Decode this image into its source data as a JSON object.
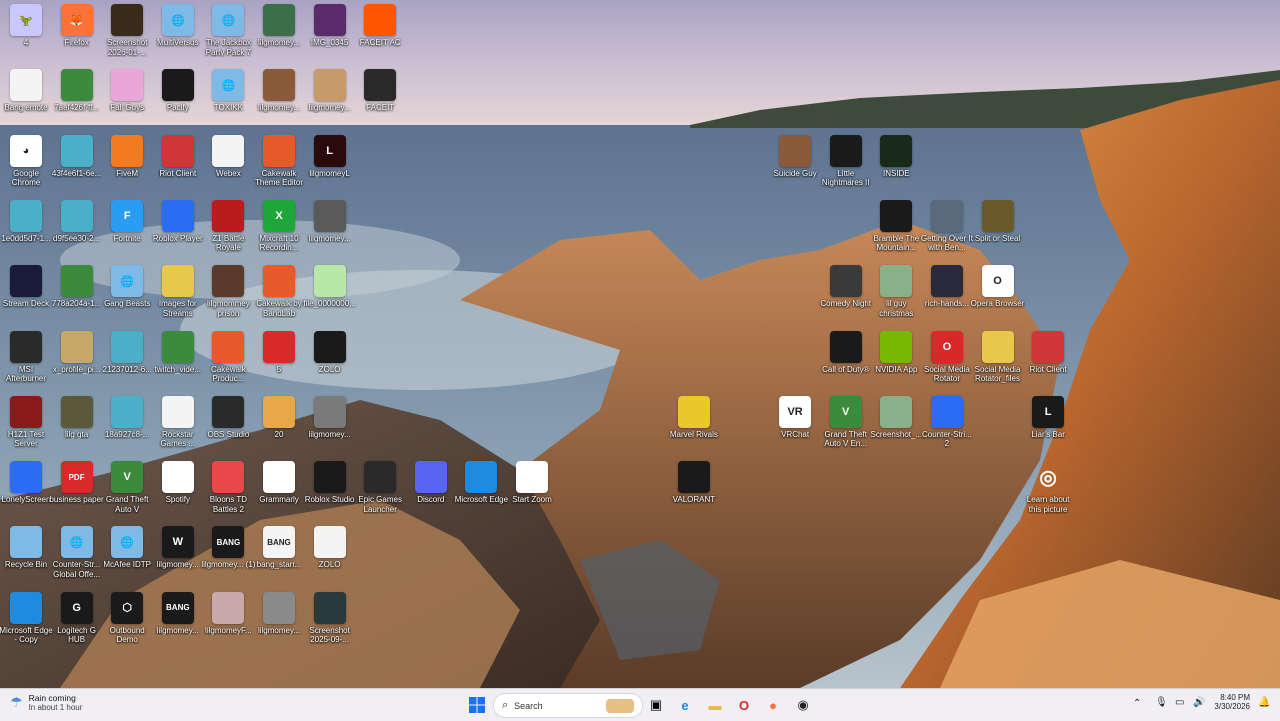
{
  "desktop": {
    "icons": [
      {
        "label": "4",
        "color": "#c8c8ff",
        "glyph": "🦖"
      },
      {
        "label": "Firefox",
        "color": "#ff7139",
        "glyph": "🦊"
      },
      {
        "label": "Screenshot 2026-01-...",
        "color": "#3a2a1a",
        "glyph": ""
      },
      {
        "label": "MultiVersus",
        "color": "#7fb9e6",
        "glyph": "🌐"
      },
      {
        "label": "The Jackbox Party Pack 7",
        "color": "#7fb9e6",
        "glyph": "🌐"
      },
      {
        "label": "lilgmomey...",
        "color": "#3c6e4a",
        "glyph": ""
      },
      {
        "label": "IMG_0345",
        "color": "#5a2a6a",
        "glyph": ""
      },
      {
        "label": "FACEIT AC",
        "color": "#ff5500",
        "glyph": ""
      },
      {
        "label": "Bang emote",
        "color": "#f4f4f4",
        "glyph": ""
      },
      {
        "label": "7aef426f-ff...",
        "color": "#3c8a3c",
        "glyph": ""
      },
      {
        "label": "Fall Guys",
        "color": "#e8a7d8",
        "glyph": ""
      },
      {
        "label": "Pacify",
        "color": "#1a1a1a",
        "glyph": ""
      },
      {
        "label": "TOXIKK",
        "color": "#7fb9e6",
        "glyph": "🌐"
      },
      {
        "label": "lilgmomey...",
        "color": "#8a5a3a",
        "glyph": ""
      },
      {
        "label": "lilgmomey...",
        "color": "#c89a6a",
        "glyph": ""
      },
      {
        "label": "FACEIT",
        "color": "#2a2a2a",
        "glyph": ""
      },
      {
        "label": "Google Chrome",
        "color": "#ffffff",
        "glyph": "◕"
      },
      {
        "label": "43f4e6f1-6e...",
        "color": "#4ab0c8",
        "glyph": ""
      },
      {
        "label": "FiveM",
        "color": "#f47a20",
        "glyph": ""
      },
      {
        "label": "Riot Client",
        "color": "#d13639",
        "glyph": ""
      },
      {
        "label": "Webex",
        "color": "#f4f4f4",
        "glyph": ""
      },
      {
        "label": "Cakewalk Theme Editor",
        "color": "#e85a2a",
        "glyph": ""
      },
      {
        "label": "lilgmomeyL",
        "color": "#2a0a0a",
        "glyph": "L"
      },
      {
        "label": "1e0dd5d7-1...",
        "color": "#4ab0c8",
        "glyph": ""
      },
      {
        "label": "d9f5ee30-2...",
        "color": "#4ab0c8",
        "glyph": ""
      },
      {
        "label": "Fortnite",
        "color": "#2a9cf4",
        "glyph": "F"
      },
      {
        "label": "Roblox Player",
        "color": "#2a6cf4",
        "glyph": ""
      },
      {
        "label": "Z1 Battle Royale",
        "color": "#b81c1c",
        "glyph": ""
      },
      {
        "label": "Mixcraft 10 Recordin...",
        "color": "#1ea83a",
        "glyph": "X"
      },
      {
        "label": "lilgmomey...",
        "color": "#5a5a5a",
        "glyph": ""
      },
      {
        "label": "Stream Deck",
        "color": "#1a1a3a",
        "glyph": ""
      },
      {
        "label": "778a204a-1...",
        "color": "#3c8a3c",
        "glyph": ""
      },
      {
        "label": "Gang Beasts",
        "color": "#7fb9e6",
        "glyph": "🌐"
      },
      {
        "label": "Images for Streams",
        "color": "#e8c84a",
        "glyph": ""
      },
      {
        "label": "lilgmommey prison",
        "color": "#5a3a2a",
        "glyph": ""
      },
      {
        "label": "Cakewalk by BandLab",
        "color": "#e85a2a",
        "glyph": ""
      },
      {
        "label": "file_0000000...",
        "color": "#b8e8a8",
        "glyph": ""
      },
      {
        "label": "MSI Afterburner",
        "color": "#2a2a2a",
        "glyph": ""
      },
      {
        "label": "x_profile_pi...",
        "color": "#c8a86a",
        "glyph": ""
      },
      {
        "label": "21237012-6...",
        "color": "#4ab0c8",
        "glyph": ""
      },
      {
        "label": "twitch_vide...",
        "color": "#3c8a3c",
        "glyph": ""
      },
      {
        "label": "Cakewalk Produc...",
        "color": "#e85a2a",
        "glyph": ""
      },
      {
        "label": "5",
        "color": "#d82a2a",
        "glyph": ""
      },
      {
        "label": "ZOLO",
        "color": "#1a1a1a",
        "glyph": ""
      },
      {
        "label": "H1Z1 Test Server",
        "color": "#8a1a1a",
        "glyph": ""
      },
      {
        "label": "lilg gta",
        "color": "#5a5a3a",
        "glyph": ""
      },
      {
        "label": "18a927c8-...",
        "color": "#4ab0c8",
        "glyph": ""
      },
      {
        "label": "Rockstar Games ...",
        "color": "#f4f4f4",
        "glyph": ""
      },
      {
        "label": "OBS Studio",
        "color": "#2a2a2a",
        "glyph": ""
      },
      {
        "label": "20",
        "color": "#e8a84a",
        "glyph": ""
      },
      {
        "label": "lilgmomey...",
        "color": "#7a7a7a",
        "glyph": ""
      },
      {
        "label": "LonelyScreen",
        "color": "#2a6cf4",
        "glyph": ""
      },
      {
        "label": "business paper",
        "color": "#d82a2a",
        "glyph": "PDF"
      },
      {
        "label": "Grand Theft Auto V",
        "color": "#3c8a3c",
        "glyph": "V"
      },
      {
        "label": "Spotify",
        "color": "#ffffff",
        "glyph": ""
      },
      {
        "label": "Bloons TD Battles 2",
        "color": "#e8484a",
        "glyph": ""
      },
      {
        "label": "Grammarly",
        "color": "#ffffff",
        "glyph": ""
      },
      {
        "label": "Roblox Studio",
        "color": "#1a1a1a",
        "glyph": ""
      },
      {
        "label": "Epic Games Launcher",
        "color": "#2a2a2a",
        "glyph": ""
      },
      {
        "label": "Discord",
        "color": "#5865f2",
        "glyph": ""
      },
      {
        "label": "Microsoft Edge",
        "color": "#1e8ae0",
        "glyph": ""
      },
      {
        "label": "Start Zoom",
        "color": "#ffffff",
        "glyph": ""
      },
      {
        "label": "Recycle Bin",
        "color": "#7fb9e6",
        "glyph": ""
      },
      {
        "label": "Counter-Str... Global Offe...",
        "color": "#7fb9e6",
        "glyph": "🌐"
      },
      {
        "label": "McAfee IDTP",
        "color": "#7fb9e6",
        "glyph": "🌐"
      },
      {
        "label": "lilgmomey...",
        "color": "#1a1a1a",
        "glyph": "W"
      },
      {
        "label": "lilgmomey... (1)",
        "color": "#1a1a1a",
        "glyph": "BANG"
      },
      {
        "label": "bang_starr...",
        "color": "#f4f4f4",
        "glyph": "BANG"
      },
      {
        "label": "ZOLO",
        "color": "#f4f4f4",
        "glyph": ""
      },
      {
        "label": "Microsoft Edge - Copy",
        "color": "#1e8ae0",
        "glyph": ""
      },
      {
        "label": "Logitech G HUB",
        "color": "#1a1a1a",
        "glyph": "G"
      },
      {
        "label": "Outbound Demo",
        "color": "#1a1a1a",
        "glyph": "⬡"
      },
      {
        "label": "lilgmomey...",
        "color": "#1a1a1a",
        "glyph": "BANG"
      },
      {
        "label": "lilgmomeyF...",
        "color": "#c8a8a8",
        "glyph": ""
      },
      {
        "label": "lilgmomey...",
        "color": "#8a8a8a",
        "glyph": ""
      },
      {
        "label": "Screenshot 2025-09-...",
        "color": "#2a3a3a",
        "glyph": ""
      },
      {
        "label": "Suicide Guy",
        "color": "#8a5a3a",
        "glyph": ""
      },
      {
        "label": "Little Nightmares II",
        "color": "#1a1a1a",
        "glyph": ""
      },
      {
        "label": "INSIDE",
        "color": "#1a2a1a",
        "glyph": ""
      },
      {
        "label": "Bramble The Mountain...",
        "color": "#1a1a1a",
        "glyph": ""
      },
      {
        "label": "Getting Over It with Ben...",
        "color": "#5a6a7a",
        "glyph": ""
      },
      {
        "label": "Split or Steal",
        "color": "#6a5a2a",
        "glyph": ""
      },
      {
        "label": "Comedy Night",
        "color": "#3a3a3a",
        "glyph": ""
      },
      {
        "label": "lil guy christmas",
        "color": "#8ab08a",
        "glyph": ""
      },
      {
        "label": "rich-hands...",
        "color": "#2a2a3a",
        "glyph": ""
      },
      {
        "label": "Opera Browser",
        "color": "#ffffff",
        "glyph": "O"
      },
      {
        "label": "Call of Duty®",
        "color": "#1a1a1a",
        "glyph": ""
      },
      {
        "label": "NVIDIA App",
        "color": "#76b900",
        "glyph": ""
      },
      {
        "label": "Social Media Rotator",
        "color": "#d8282a",
        "glyph": "O"
      },
      {
        "label": "Social Media Rotator_files",
        "color": "#e8c84a",
        "glyph": ""
      },
      {
        "label": "Riot Client",
        "color": "#d13639",
        "glyph": ""
      },
      {
        "label": "Marvel Rivals",
        "color": "#e8c82a",
        "glyph": ""
      },
      {
        "label": "VRChat",
        "color": "#ffffff",
        "glyph": "VR"
      },
      {
        "label": "Grand Theft Auto V En...",
        "color": "#3c8a3c",
        "glyph": "V"
      },
      {
        "label": "Screenshot_...",
        "color": "#8ab08a",
        "glyph": ""
      },
      {
        "label": "Counter-Stri... 2",
        "color": "#2a6cf4",
        "glyph": ""
      },
      {
        "label": "Liar's Bar",
        "color": "#1a1a1a",
        "glyph": "L"
      },
      {
        "label": "VALORANT",
        "color": "#1a1a1a",
        "glyph": ""
      },
      {
        "label": "Learn about this picture",
        "color": "transparent",
        "glyph": "◎"
      }
    ]
  },
  "taskbar": {
    "weather_title": "Rain coming",
    "weather_sub": "In about 1 hour",
    "search_placeholder": "Search",
    "time": "8:40 PM",
    "date": "3/30/2026"
  }
}
